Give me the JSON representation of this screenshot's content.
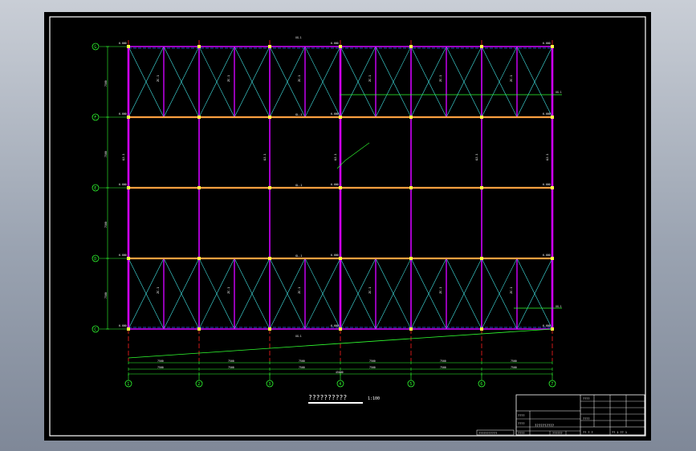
{
  "colors": {
    "background": "#000000",
    "frame": "#ffffff",
    "column": "#d000ff",
    "beam_orange": "#ffa040",
    "grid_red": "#ff2020",
    "bracing_cyan": "#40e0e0",
    "dimension_green": "#30ff30",
    "text_white": "#ffffff",
    "text_yellow": "#ffff40"
  },
  "drawing": {
    "title": "??????????",
    "scale": "1:100",
    "grid_axes_vertical": [
      "1",
      "2",
      "3",
      "4",
      "5",
      "6",
      "7"
    ],
    "grid_axes_horizontal": [
      "G",
      "F",
      "E",
      "D",
      "C"
    ],
    "elevation_label": "6.000",
    "column_label": "GJ-1",
    "beam_label": "GL-1",
    "strut_label": "XG-1",
    "bracing_label": "ZC-1",
    "dim_top_labels": [
      "7500",
      "7500",
      "7500",
      "7500",
      "7500",
      "7500"
    ],
    "dim_bottom_labels": [
      "7500",
      "7500",
      "7500",
      "7500",
      "7500",
      "7500"
    ],
    "dim_total": "45000",
    "dim_left_labels": [
      "7500",
      "7500",
      "7500",
      "7500"
    ]
  },
  "title_block": {
    "project_name": "??????????",
    "drawing_name": "??????",
    "rows": [
      "????",
      "????",
      "????",
      "????",
      "????"
    ],
    "sheet_info": "?? 1 ?? 1",
    "drawing_no": "?? ? ?",
    "footer_note": "???????????"
  }
}
